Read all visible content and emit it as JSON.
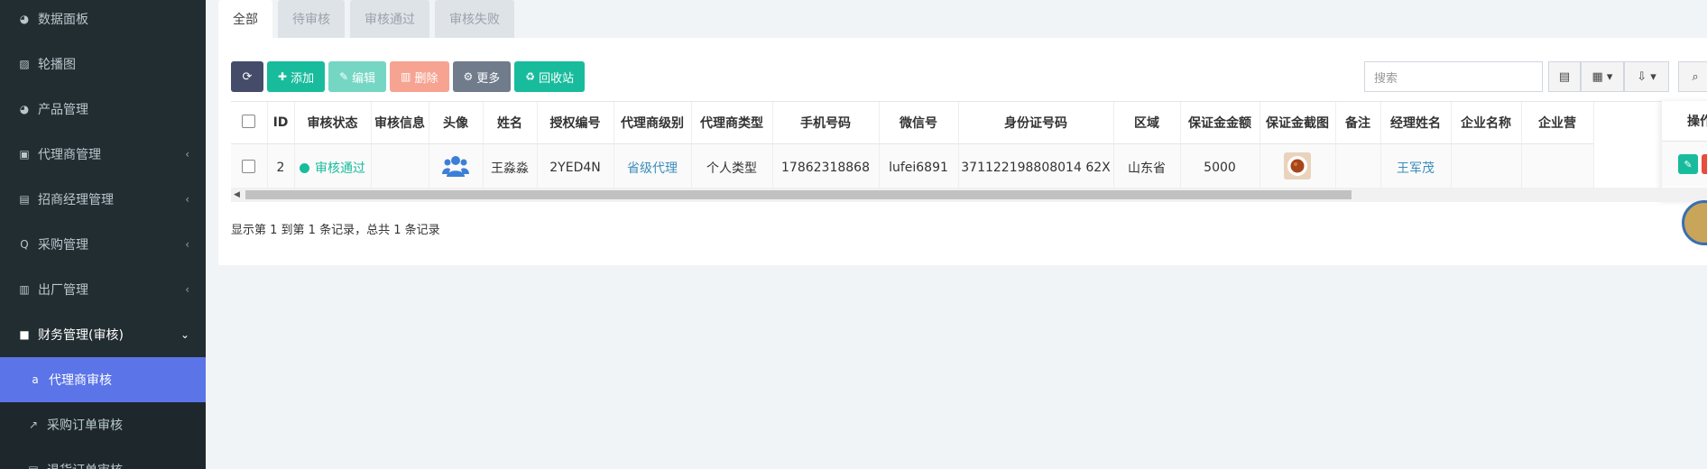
{
  "sidebar": {
    "items": [
      {
        "label": "数据面板",
        "icon": "dashboard-icon"
      },
      {
        "label": "轮播图",
        "icon": "image-icon"
      },
      {
        "label": "产品管理",
        "icon": "product-icon"
      },
      {
        "label": "代理商管理",
        "icon": "agent-card-icon"
      },
      {
        "label": "招商经理管理",
        "icon": "manager-icon"
      },
      {
        "label": "采购管理",
        "icon": "purchase-icon"
      },
      {
        "label": "出厂管理",
        "icon": "truck-icon"
      },
      {
        "label": "财务管理(审核)",
        "icon": "finance-icon"
      }
    ],
    "sub_items": [
      {
        "label": "代理商审核",
        "icon": "amazon-icon"
      },
      {
        "label": "采购订单审核",
        "icon": "chart-line-icon"
      },
      {
        "label": "退货订单审核",
        "icon": "return-icon"
      }
    ]
  },
  "tabs": [
    {
      "label": "全部"
    },
    {
      "label": "待审核"
    },
    {
      "label": "审核通过"
    },
    {
      "label": "审核失败"
    }
  ],
  "toolbar": {
    "add": "添加",
    "edit": "编辑",
    "delete": "删除",
    "more": "更多",
    "recycle": "回收站"
  },
  "search": {
    "placeholder": "搜索"
  },
  "table": {
    "headers": [
      "ID",
      "审核状态",
      "审核信息",
      "头像",
      "姓名",
      "授权编号",
      "代理商级别",
      "代理商类型",
      "手机号码",
      "微信号",
      "身份证号码",
      "区域",
      "保证金金额",
      "保证金截图",
      "备注",
      "经理姓名",
      "企业名称",
      "企业营"
    ],
    "operation_header": "操作",
    "rows": [
      {
        "id": "2",
        "status": "审核通过",
        "info": "",
        "name": "王淼淼",
        "auth_no": "2YED4N",
        "level": "省级代理",
        "type": "个人类型",
        "phone": "17862318868",
        "wechat": "lufei6891",
        "id_card": "371122198808014 62X",
        "region": "山东省",
        "deposit": "5000",
        "remark": "",
        "manager": "王军茂",
        "company": "",
        "company2": ""
      }
    ]
  },
  "summary": "显示第 1 到第 1 条记录，总共 1 条记录",
  "colors": {
    "accent": "#5b74e8",
    "success": "#18bc9c",
    "danger": "#e74c3c",
    "link": "#3c8dbc"
  }
}
